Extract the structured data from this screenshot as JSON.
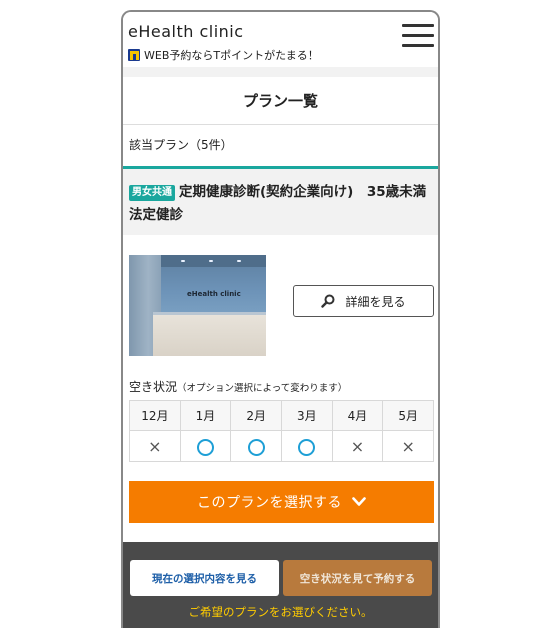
{
  "header": {
    "logo": "eHealth clinic",
    "tagline": "WEB予約ならTポイントがたまる！",
    "tpoint_icon": "tpoint-logo-icon",
    "menu_icon": "hamburger-menu-icon"
  },
  "page": {
    "title": "プラン一覧",
    "count": "該当プラン（5件）"
  },
  "plan": {
    "badge": "男女共通",
    "title": "定期健康診断(契約企業向け)　35歳未満法定健診",
    "photo_sign": "eHealth clinic",
    "detail_button": "詳細を見る",
    "detail_icon": "search-icon",
    "availability_label": "空き状況",
    "availability_note": "（オプション選択によって変わります）",
    "availability": {
      "months": [
        "12月",
        "1月",
        "2月",
        "3月",
        "4月",
        "5月"
      ],
      "marks": [
        "×",
        "○",
        "○",
        "○",
        "×",
        "×"
      ]
    },
    "select_button": "このプランを選択する",
    "select_icon": "chevron-down-icon"
  },
  "footer": {
    "current_selection_button": "現在の選択内容を見る",
    "reserve_button": "空き状況を見て予約する",
    "hint": "ご希望のプランをお選びください。"
  },
  "colors": {
    "accent_teal": "#1aa79e",
    "select_orange": "#f57c00",
    "reserve_brown": "#b87a3d",
    "circle_blue": "#1e9fd6",
    "hint_yellow": "#ffcc00",
    "bottom_bar": "#4a4a4a"
  }
}
